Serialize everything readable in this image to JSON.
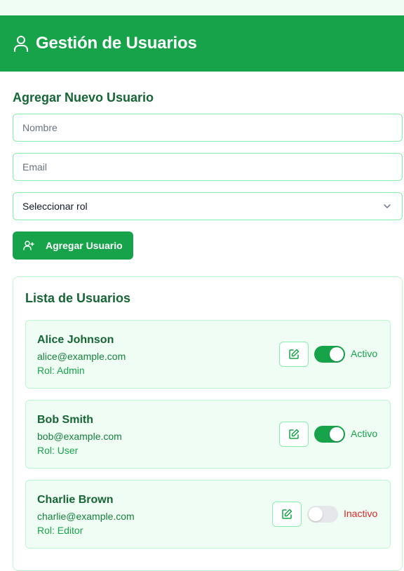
{
  "header": {
    "title": "Gestión de Usuarios"
  },
  "form": {
    "title": "Agregar Nuevo Usuario",
    "name_placeholder": "Nombre",
    "email_placeholder": "Email",
    "role_select": "Seleccionar rol",
    "submit_label": "Agregar Usuario"
  },
  "list": {
    "title": "Lista de Usuarios",
    "users": [
      {
        "name": "Alice Johnson",
        "email": "alice@example.com",
        "role": "Rol: Admin",
        "status": "Activo",
        "active": true
      },
      {
        "name": "Bob Smith",
        "email": "bob@example.com",
        "role": "Rol: User",
        "status": "Activo",
        "active": true
      },
      {
        "name": "Charlie Brown",
        "email": "charlie@example.com",
        "role": "Rol: Editor",
        "status": "Inactivo",
        "active": false
      }
    ]
  },
  "colors": {
    "primary": "#16a34a",
    "dark": "#166534",
    "light_bg": "#f0fdf4",
    "border": "#86efac",
    "inactive": "#dc2626"
  },
  "icons": {
    "header": "user-icon",
    "add": "user-plus-icon",
    "edit": "edit-icon",
    "select": "chevron-down-icon"
  }
}
